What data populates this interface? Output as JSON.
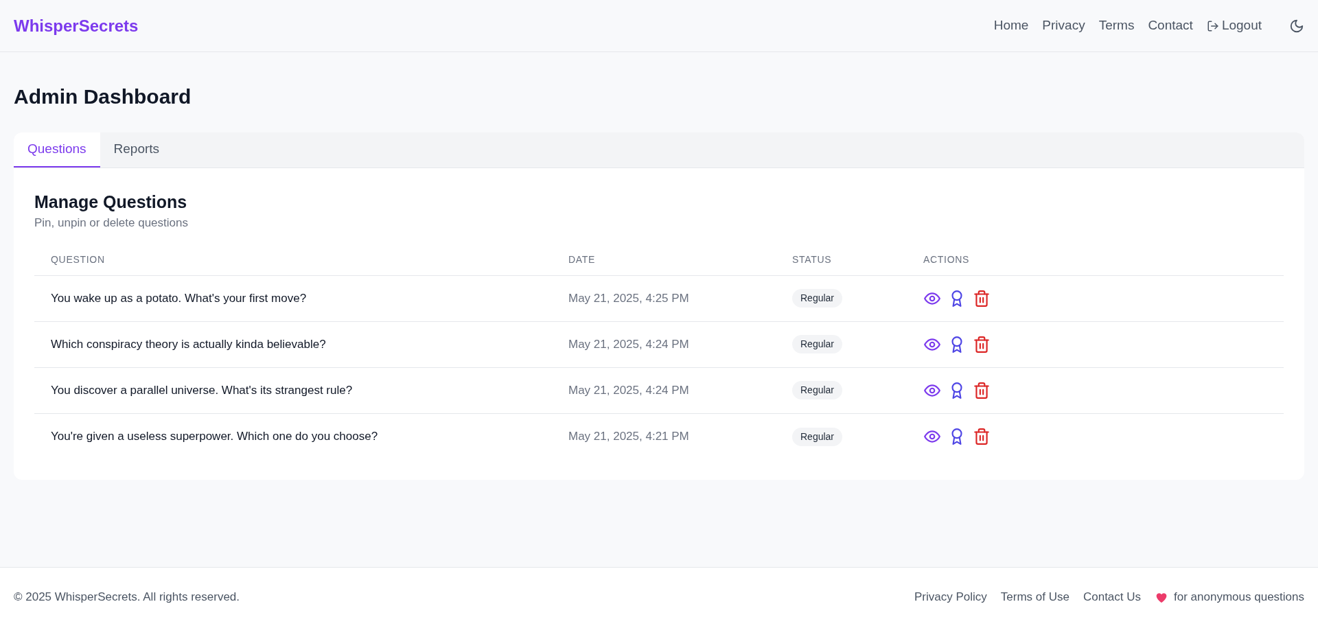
{
  "header": {
    "logo": "WhisperSecrets",
    "nav": [
      "Home",
      "Privacy",
      "Terms",
      "Contact"
    ],
    "logout": "Logout"
  },
  "page_title": "Admin Dashboard",
  "tabs": [
    {
      "label": "Questions",
      "selected": true
    },
    {
      "label": "Reports",
      "selected": false
    }
  ],
  "panel": {
    "title": "Manage Questions",
    "subtitle": "Pin, unpin or delete questions"
  },
  "table": {
    "columns": [
      "QUESTION",
      "DATE",
      "STATUS",
      "ACTIONS"
    ],
    "rows": [
      {
        "question": "You wake up as a potato. What's your first move?",
        "date": "May 21, 2025, 4:25 PM",
        "status": "Regular"
      },
      {
        "question": "Which conspiracy theory is actually kinda believable?",
        "date": "May 21, 2025, 4:24 PM",
        "status": "Regular"
      },
      {
        "question": "You discover a parallel universe. What's its strangest rule?",
        "date": "May 21, 2025, 4:24 PM",
        "status": "Regular"
      },
      {
        "question": "You're given a useless superpower. Which one do you choose?",
        "date": "May 21, 2025, 4:21 PM",
        "status": "Regular"
      }
    ]
  },
  "footer": {
    "copyright": "© 2025 WhisperSecrets. All rights reserved.",
    "links": [
      "Privacy Policy",
      "Terms of Use",
      "Contact Us"
    ],
    "tagline": "for anonymous questions"
  }
}
